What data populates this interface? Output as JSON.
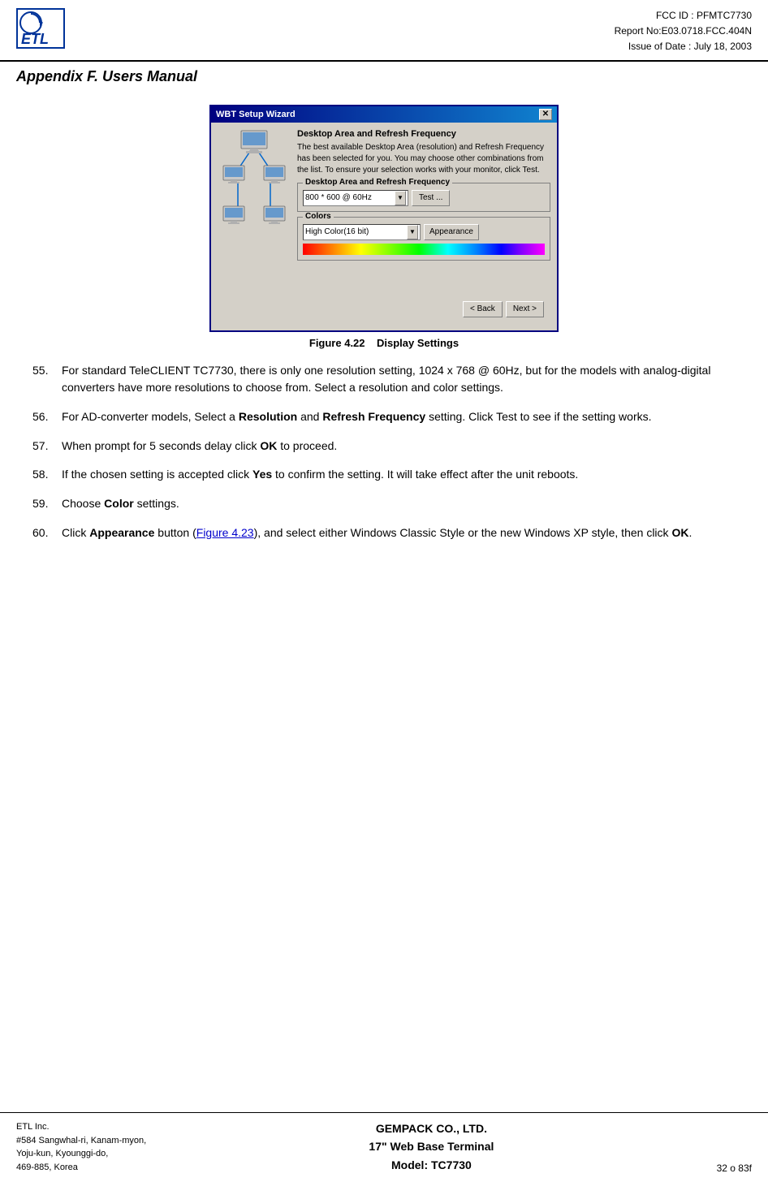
{
  "header": {
    "logo_text": "ETL",
    "fcc_id": "FCC ID : PFMTC7730",
    "report_no": "Report No:E03.0718.FCC.404N",
    "issue_date": "Issue of Date : July 18, 2003",
    "appendix_title": "Appendix F.  Users Manual"
  },
  "dialog": {
    "title": "WBT Setup Wizard",
    "close_btn": "✕",
    "section_title": "Desktop Area and Refresh Frequency",
    "description": "The best available Desktop Area (resolution) and Refresh Frequency has been selected for you.  You may choose other combinations from the list.  To ensure your selection works with your monitor, click Test.",
    "group1": {
      "label": "Desktop Area and Refresh Frequency",
      "resolution_value": "800 * 600 @ 60Hz",
      "test_btn": "Test ..."
    },
    "group2": {
      "label": "Colors",
      "color_value": "High Color(16 bit)",
      "appearance_btn": "Appearance"
    },
    "back_btn": "< Back",
    "next_btn": "Next >"
  },
  "figure": {
    "number": "Figure 4.22",
    "title": "Display Settings"
  },
  "paragraphs": [
    {
      "num": "55.",
      "text": "For standard TeleCLIENT TC7730, there is only one resolution setting, 1024 x 768 @ 60Hz, but for the models with analog-digital converters have more resolutions to choose from.  Select a resolution and color settings."
    },
    {
      "num": "56.",
      "text_parts": [
        {
          "text": "For AD-converter models, Select a ",
          "bold": false
        },
        {
          "text": "Resolution",
          "bold": true
        },
        {
          "text": " and ",
          "bold": false
        },
        {
          "text": "Refresh Frequency",
          "bold": true
        },
        {
          "text": " setting.  Click Test to see if the setting works.",
          "bold": false
        }
      ]
    },
    {
      "num": "57.",
      "text_parts": [
        {
          "text": "When prompt for 5 seconds delay click ",
          "bold": false
        },
        {
          "text": "OK",
          "bold": true
        },
        {
          "text": " to proceed.",
          "bold": false
        }
      ]
    },
    {
      "num": "58.",
      "text_parts": [
        {
          "text": "If the chosen setting is accepted click ",
          "bold": false
        },
        {
          "text": "Yes",
          "bold": true
        },
        {
          "text": " to confirm the setting.  It will take effect after the unit reboots.",
          "bold": false
        }
      ]
    },
    {
      "num": "59.",
      "text_parts": [
        {
          "text": "Choose ",
          "bold": false
        },
        {
          "text": "Color",
          "bold": true
        },
        {
          "text": " settings.",
          "bold": false
        }
      ]
    },
    {
      "num": "60.",
      "text_parts": [
        {
          "text": "Click ",
          "bold": false
        },
        {
          "text": "Appearance",
          "bold": true
        },
        {
          "text": " button (",
          "bold": false
        },
        {
          "text": "Figure 4.23",
          "bold": false,
          "underline": true,
          "link": true
        },
        {
          "text": "), and select either Windows Classic Style or the new Windows XP style, then click ",
          "bold": false
        },
        {
          "text": "OK",
          "bold": true
        },
        {
          "text": ".",
          "bold": false
        }
      ]
    }
  ],
  "footer": {
    "company_line1": "ETL Inc.",
    "company_line2": "#584 Sangwhal-ri, Kanam-myon,",
    "company_line3": "Yoju-kun, Kyounggi-do,",
    "company_line4": "469-885, Korea",
    "center_line1": "GEMPACK CO., LTD.",
    "center_line2": "17\" Web Base Terminal",
    "center_line3": "Model: TC7730",
    "page_info": "32 o 83f"
  }
}
